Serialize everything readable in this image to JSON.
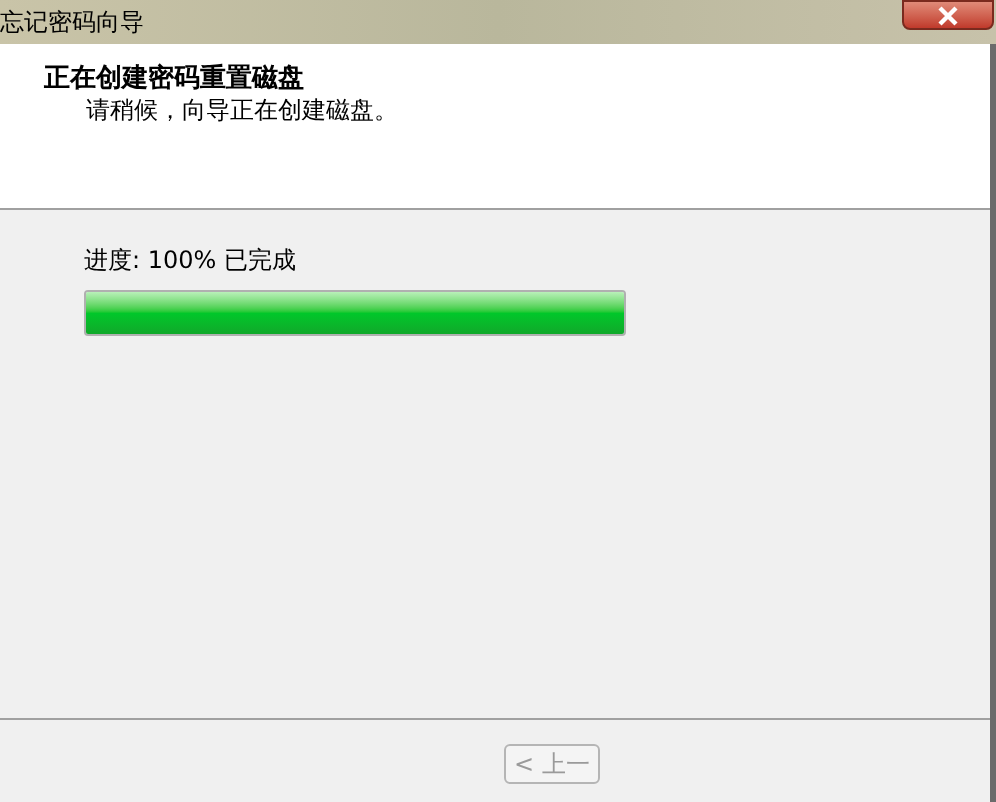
{
  "window": {
    "title": "忘记密码向导"
  },
  "header": {
    "title": "正在创建密码重置磁盘",
    "subtitle": "请稍候，向导正在创建磁盘。"
  },
  "progress": {
    "label": "进度: 100% 已完成",
    "level": 1
  },
  "buttons": [
    {
      "label": "< 上一",
      "disabled": true
    }
  ]
}
